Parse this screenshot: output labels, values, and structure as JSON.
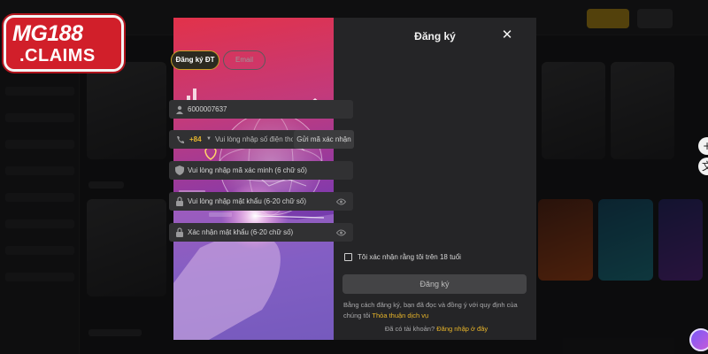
{
  "logo": {
    "line1": "MG188",
    "line2": ".CLAIMS"
  },
  "modal": {
    "title": "Đăng ký",
    "tabs": [
      {
        "label": "Đăng ký ĐT",
        "active": true
      },
      {
        "label": "Email",
        "active": false
      }
    ],
    "fields": {
      "username_value": "6000007637",
      "phone_code": "+84",
      "phone_placeholder": "Vui lòng nhập số điện thoại",
      "send_code_label": "Gửi mã xác nhận",
      "verify_placeholder": "Vui lòng nhập mã xác minh (6 chữ số)",
      "password_placeholder": "Vui lòng nhập mật khẩu (6-20 chữ số)",
      "confirm_placeholder": "Xác nhận mật khẩu (6-20 chữ số)"
    },
    "age_check_label": "Tôi xác nhận rằng tôi trên 18 tuổi",
    "age_checked": false,
    "submit_label": "Đăng ký",
    "terms_text": "Bằng cách đăng ký, bạn đã đọc và đồng ý với quy định của chúng tôi",
    "terms_link": "Thỏa thuận dịch vụ",
    "login_prompt": "Đã có tài khoản?",
    "login_link": "Đăng nhập ở đây"
  },
  "icons": {
    "user": "user-icon",
    "phone": "phone-icon",
    "shield": "shield-icon",
    "lock": "lock-icon",
    "eye": "eye-icon",
    "close": "close-icon"
  },
  "colors": {
    "accent": "#e8b52a",
    "modal_bg": "#252527",
    "field_bg": "#313133",
    "logo_red": "#d11f2a"
  }
}
